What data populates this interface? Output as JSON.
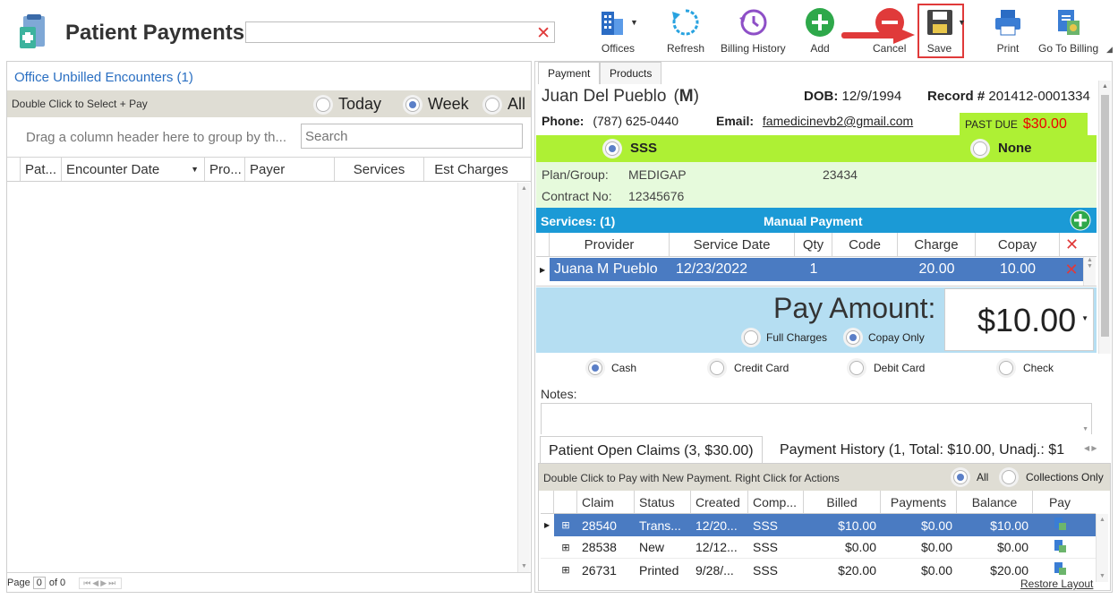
{
  "header": {
    "title": "Patient Payments",
    "search_value": ""
  },
  "toolbar": {
    "offices": "Offices",
    "refresh": "Refresh",
    "billing_history": "Billing History",
    "add": "Add",
    "cancel": "Cancel",
    "save": "Save",
    "print": "Print",
    "go_to_billing": "Go To Billing"
  },
  "left": {
    "title": "Office Unbilled Encounters (1)",
    "hint": "Double Click to Select + Pay",
    "filters": [
      "Today",
      "Week",
      "All"
    ],
    "filter_selected": "Week",
    "group_hint": "Drag a column header here to group by th...",
    "search_placeholder": "Search",
    "columns": [
      "Pat...",
      "Encounter Date",
      "Pro...",
      "Payer",
      "Services",
      "Est Charges"
    ],
    "pager": {
      "label": "Page",
      "page": "0",
      "of": "of 0"
    }
  },
  "right": {
    "tabs": [
      "Payment",
      "Products"
    ],
    "patient": {
      "name": "Juan Del Pueblo",
      "sex": "M",
      "dob_label": "DOB:",
      "dob": "12/9/1994",
      "record_label": "Record #",
      "record": "201412-0001334",
      "phone_label": "Phone:",
      "phone": "(787) 625-0440",
      "email_label": "Email:",
      "email": "famedicinevb2@gmail.com",
      "past_due_label": "PAST DUE",
      "past_due": "$30.00"
    },
    "insurance": {
      "option1": "SSS",
      "option2": "None",
      "plan_label": "Plan/Group:",
      "plan": "MEDIGAP",
      "group": "23434",
      "contract_label": "Contract No:",
      "contract": "12345676"
    },
    "services": {
      "title": "Services: (1)",
      "manual": "Manual Payment",
      "columns": [
        "Provider",
        "Service Date",
        "Qty",
        "Code",
        "Charge",
        "Copay"
      ],
      "rows": [
        {
          "provider": "Juana M Pueblo",
          "date": "12/23/2022",
          "qty": "1",
          "code": "",
          "charge": "20.00",
          "copay": "10.00"
        }
      ]
    },
    "pay": {
      "label": "Pay Amount:",
      "amount": "$10.00",
      "full_charges": "Full Charges",
      "copay_only": "Copay Only",
      "methods": [
        "Cash",
        "Credit Card",
        "Debit Card",
        "Check"
      ],
      "method_selected": "Cash",
      "notes_label": "Notes:"
    },
    "claims": {
      "tab1": "Patient Open Claims (3, $30.00)",
      "tab2": "Payment History (1, Total: $10.00, Unadj.: $1",
      "hint": "Double Click to Pay with New Payment. Right Click for Actions",
      "all": "All",
      "collections": "Collections Only",
      "columns": [
        "Claim",
        "Status",
        "Created",
        "Comp...",
        "Billed",
        "Payments",
        "Balance",
        "Pay"
      ],
      "rows": [
        {
          "claim": "28540",
          "status": "Trans...",
          "created": "12/20...",
          "comp": "SSS",
          "billed": "$10.00",
          "payments": "$0.00",
          "balance": "$10.00"
        },
        {
          "claim": "28538",
          "status": "New",
          "created": "12/12...",
          "comp": "SSS",
          "billed": "$0.00",
          "payments": "$0.00",
          "balance": "$0.00"
        },
        {
          "claim": "26731",
          "status": "Printed",
          "created": "9/28/...",
          "comp": "SSS",
          "billed": "$20.00",
          "payments": "$0.00",
          "balance": "$20.00"
        }
      ],
      "restore_layout": "Restore Layout"
    }
  },
  "colors": {
    "accent_green": "#aef034",
    "light_green": "#e6fadc",
    "blue_bar": "#1b9ad6",
    "pay_bg": "#b5def2",
    "selected_row": "#4a7bc2",
    "highlight_red": "#e03a3a"
  }
}
